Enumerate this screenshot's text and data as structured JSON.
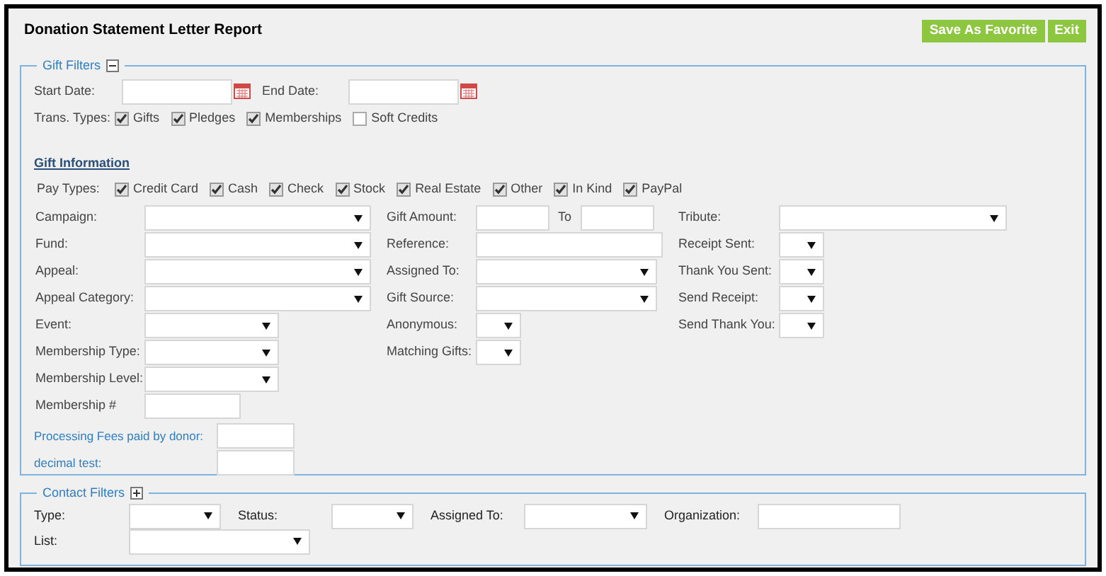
{
  "title": "Donation Statement Letter Report",
  "buttons": [
    {
      "label": "Save As Favorite"
    },
    {
      "label": "Exit"
    }
  ],
  "gift_filters": {
    "legend": "Gift Filters",
    "expanded": true,
    "start_date_label": "Start Date:",
    "end_date_label": "End Date:",
    "trans_types_label": "Trans. Types:",
    "trans_types": [
      {
        "label": "Gifts",
        "checked": true
      },
      {
        "label": "Pledges",
        "checked": true
      },
      {
        "label": "Memberships",
        "checked": true
      },
      {
        "label": "Soft Credits",
        "checked": false
      }
    ]
  },
  "gift_information": {
    "heading": "Gift Information",
    "pay_types_label": "Pay Types:",
    "pay_types": [
      {
        "label": "Credit Card",
        "checked": true
      },
      {
        "label": "Cash",
        "checked": true
      },
      {
        "label": "Check",
        "checked": true
      },
      {
        "label": "Stock",
        "checked": true
      },
      {
        "label": "Real Estate",
        "checked": true
      },
      {
        "label": "Other",
        "checked": true
      },
      {
        "label": "In Kind",
        "checked": true
      },
      {
        "label": "PayPal",
        "checked": true
      }
    ],
    "columns": [
      [
        {
          "label": "Campaign:",
          "kind": "select"
        },
        {
          "label": "Fund:",
          "kind": "select"
        },
        {
          "label": "Appeal:",
          "kind": "select"
        },
        {
          "label": "Appeal Category:",
          "kind": "select"
        },
        {
          "label": "Event:",
          "kind": "select"
        },
        {
          "label": "Membership Type:",
          "kind": "select"
        },
        {
          "label": "Membership Level:",
          "kind": "select"
        },
        {
          "label": "Membership #",
          "kind": "text"
        }
      ],
      [
        {
          "label": "Gift Amount:",
          "kind": "range",
          "to_label": "To"
        },
        {
          "label": "Reference:",
          "kind": "text"
        },
        {
          "label": "Assigned To:",
          "kind": "select"
        },
        {
          "label": "Gift Source:",
          "kind": "select"
        },
        {
          "label": "Anonymous:",
          "kind": "select"
        },
        {
          "label": "Matching Gifts:",
          "kind": "select"
        }
      ],
      [
        {
          "label": "Tribute:",
          "kind": "select"
        },
        {
          "label": "Receipt Sent:",
          "kind": "select"
        },
        {
          "label": "Thank You Sent:",
          "kind": "select"
        },
        {
          "label": "Send Receipt:",
          "kind": "select"
        },
        {
          "label": "Send Thank You:",
          "kind": "select"
        }
      ]
    ],
    "custom_fields": [
      {
        "label": "Processing Fees paid by donor:",
        "kind": "text"
      },
      {
        "label": "decimal test:",
        "kind": "text"
      }
    ]
  },
  "contact_filters": {
    "legend": "Contact Filters",
    "expanded": false,
    "fields": [
      {
        "label": "Type:",
        "kind": "select"
      },
      {
        "label": "Status:",
        "kind": "select"
      },
      {
        "label": "Assigned To:",
        "kind": "select"
      },
      {
        "label": "Organization:",
        "kind": "text"
      },
      {
        "label": "List:",
        "kind": "select"
      }
    ]
  }
}
